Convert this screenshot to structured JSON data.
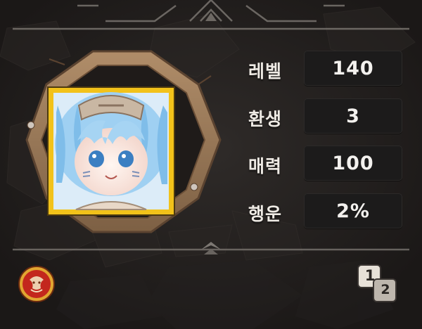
{
  "profile": {
    "portrait_icon": "character-portrait",
    "frame_icon": "octagon-wood-frame"
  },
  "stats": [
    {
      "label": "레벨",
      "value": "140"
    },
    {
      "label": "환생",
      "value": "3"
    },
    {
      "label": "매력",
      "value": "100"
    },
    {
      "label": "행운",
      "value": "2%"
    }
  ],
  "footer": {
    "badge_icon": "red-guild-badge",
    "page_toggle": {
      "primary": "1",
      "secondary": "2"
    }
  },
  "colors": {
    "panel_bg": "#1f1b19",
    "frame_wood": "#9a7a58",
    "portrait_border": "#f2c21a",
    "value_box": "#1c1b1b",
    "text": "#f3f1ee"
  }
}
